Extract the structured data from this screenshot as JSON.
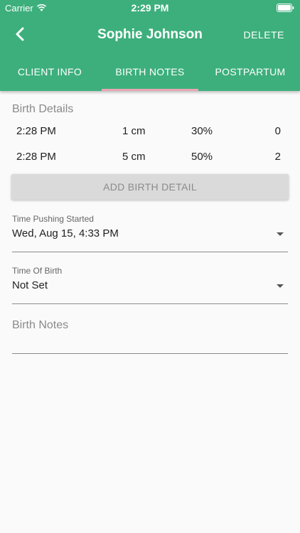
{
  "status_bar": {
    "carrier": "Carrier",
    "time": "2:29 PM"
  },
  "nav": {
    "title": "Sophie Johnson",
    "delete_label": "DELETE"
  },
  "tabs": [
    {
      "label": "CLIENT INFO"
    },
    {
      "label": "BIRTH NOTES"
    },
    {
      "label": "POSTPARTUM"
    }
  ],
  "active_tab": "BIRTH NOTES",
  "colors": {
    "header": "#3daf7c",
    "tab_indicator": "#e8a6b4"
  },
  "birth_details": {
    "title": "Birth Details",
    "rows": [
      {
        "time": "2:28 PM",
        "dilation": "1 cm",
        "effacement": "30%",
        "station": "0"
      },
      {
        "time": "2:28 PM",
        "dilation": "5 cm",
        "effacement": "50%",
        "station": "2"
      }
    ],
    "add_button": "ADD BIRTH DETAIL"
  },
  "time_pushing": {
    "label": "Time Pushing Started",
    "value": "Wed, Aug 15, 4:33 PM"
  },
  "time_of_birth": {
    "label": "Time Of Birth",
    "value": "Not Set"
  },
  "birth_notes": {
    "placeholder": "Birth Notes",
    "value": ""
  }
}
